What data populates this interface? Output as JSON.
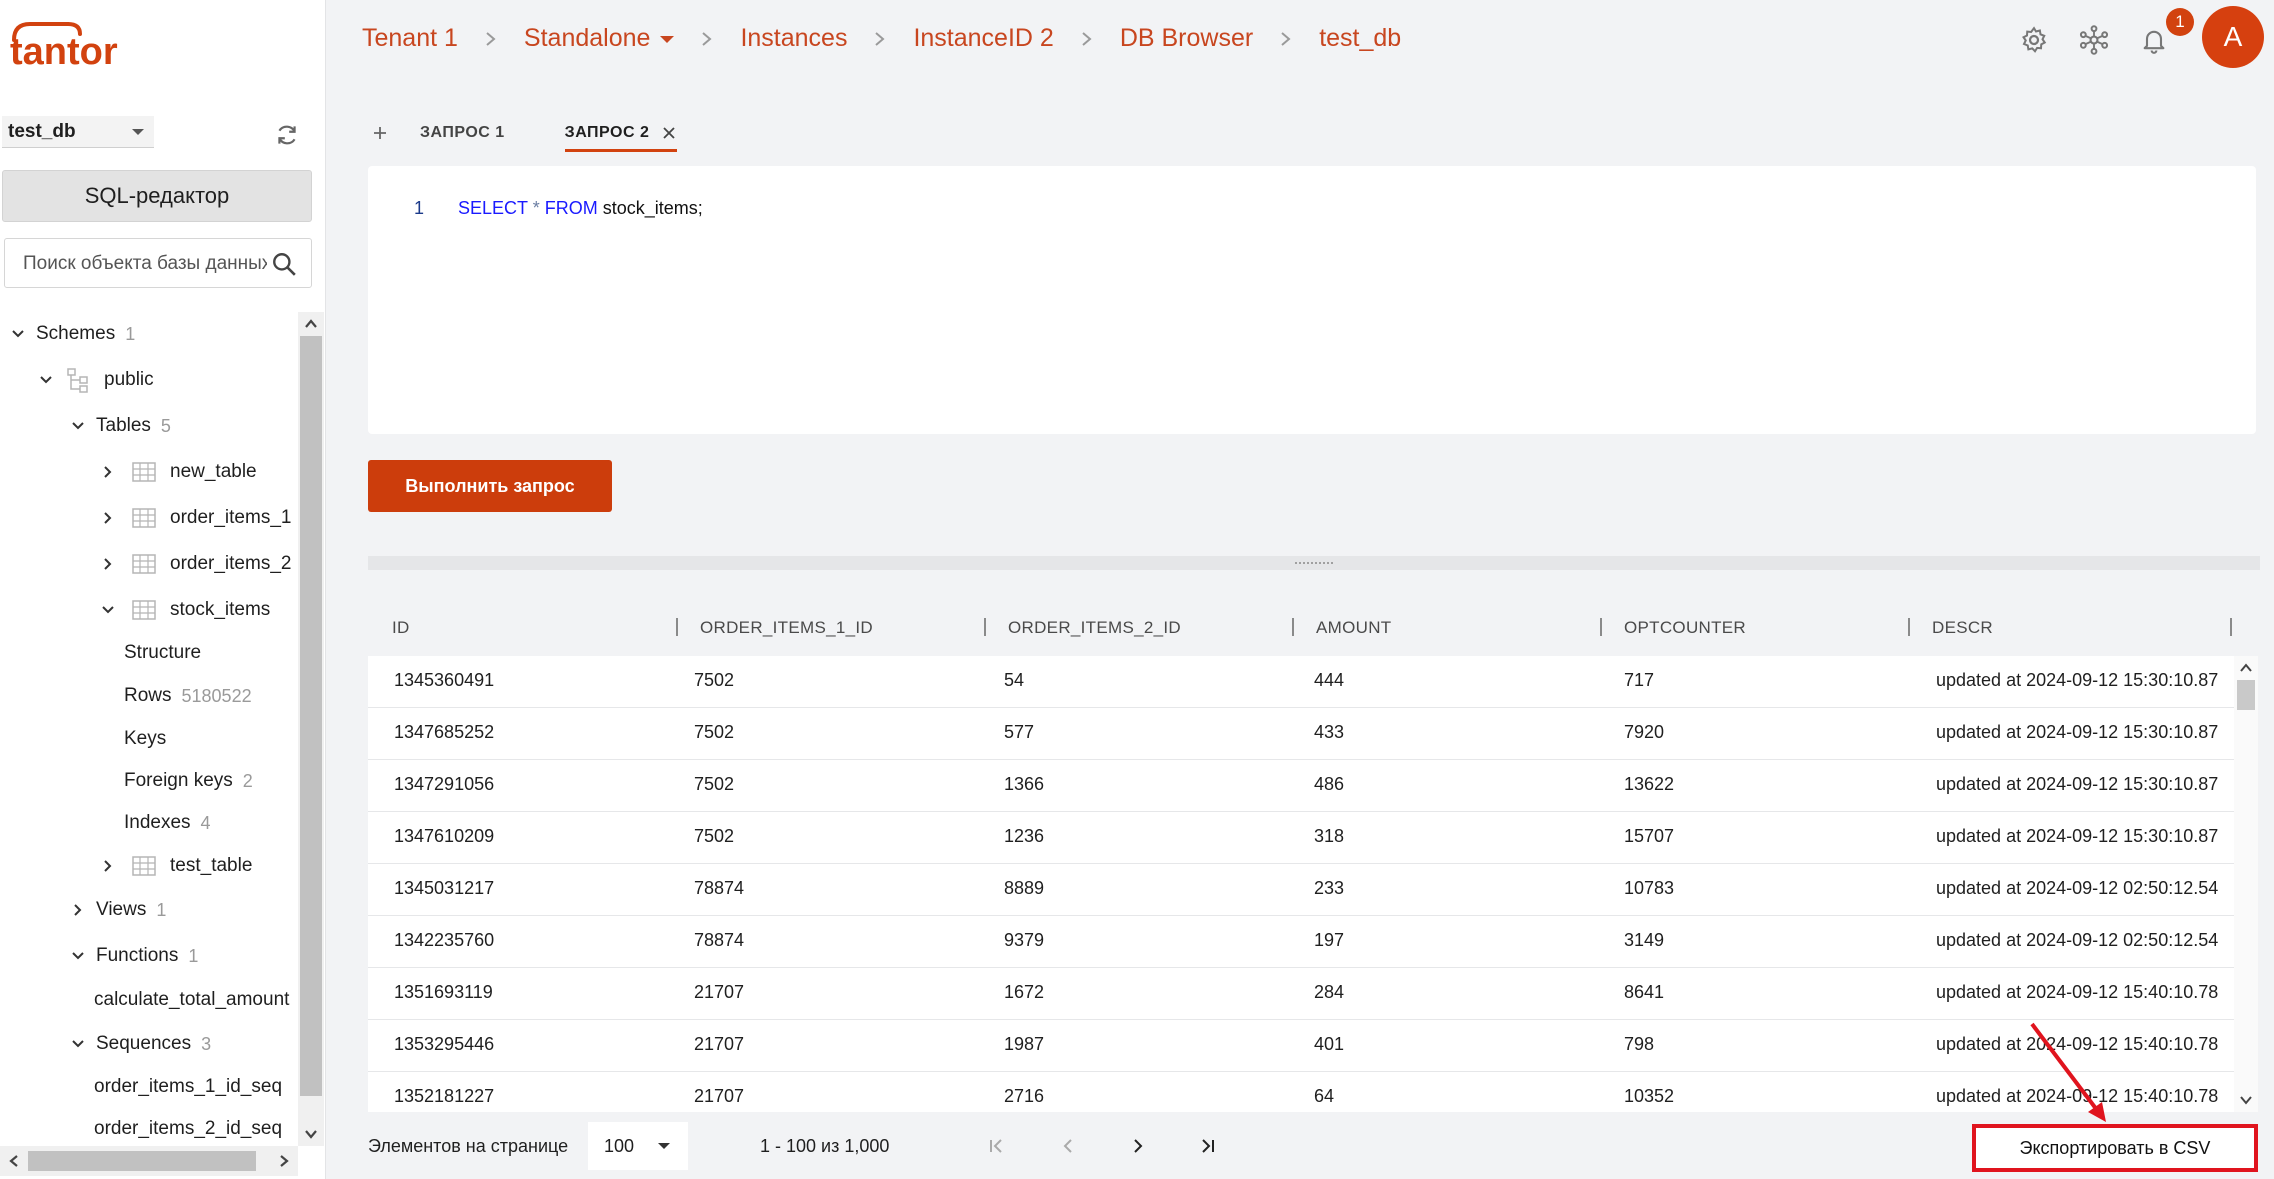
{
  "brand": {
    "logo_text": "tantor",
    "accent": "#d2420f"
  },
  "sidebar": {
    "database": "test_db",
    "sql_editor_label": "SQL-редактор",
    "search_placeholder": "Поиск объекта базы данных",
    "tree": {
      "schemes": {
        "label": "Schemes",
        "count": "1"
      },
      "public": {
        "label": "public"
      },
      "tables": {
        "label": "Tables",
        "count": "5"
      },
      "table_new": {
        "label": "new_table"
      },
      "table_oi1": {
        "label": "order_items_1"
      },
      "table_oi2": {
        "label": "order_items_2"
      },
      "table_stock": {
        "label": "stock_items"
      },
      "structure": {
        "label": "Structure"
      },
      "rows": {
        "label": "Rows",
        "count": "5180522"
      },
      "keys": {
        "label": "Keys"
      },
      "foreign_keys": {
        "label": "Foreign keys",
        "count": "2"
      },
      "indexes": {
        "label": "Indexes",
        "count": "4"
      },
      "table_test": {
        "label": "test_table"
      },
      "views": {
        "label": "Views",
        "count": "1"
      },
      "functions": {
        "label": "Functions",
        "count": "1"
      },
      "fn_calc": {
        "label": "calculate_total_amount"
      },
      "sequences": {
        "label": "Sequences",
        "count": "3"
      },
      "seq1": {
        "label": "order_items_1_id_seq"
      },
      "seq2": {
        "label": "order_items_2_id_seq"
      }
    }
  },
  "header": {
    "breadcrumb": [
      "Tenant 1",
      "Standalone",
      "Instances",
      "InstanceID 2",
      "DB Browser",
      "test_db"
    ],
    "notification_count": "1",
    "avatar_letter": "A"
  },
  "query_tabs": {
    "tab1": "ЗАПРОС 1",
    "tab2": "ЗАПРОС 2"
  },
  "editor": {
    "line_number": "1",
    "kw_select": "SELECT",
    "star": "*",
    "kw_from": "FROM",
    "rest": "stock_items;"
  },
  "run_button_label": "Выполнить запрос",
  "results": {
    "columns": [
      "ID",
      "ORDER_ITEMS_1_ID",
      "ORDER_ITEMS_2_ID",
      "AMOUNT",
      "OPTCOUNTER",
      "DESCR"
    ],
    "rows": [
      [
        "1345360491",
        "7502",
        "54",
        "444",
        "717",
        "updated at 2024-09-12 15:30:10.87"
      ],
      [
        "1347685252",
        "7502",
        "577",
        "433",
        "7920",
        "updated at 2024-09-12 15:30:10.87"
      ],
      [
        "1347291056",
        "7502",
        "1366",
        "486",
        "13622",
        "updated at 2024-09-12 15:30:10.87"
      ],
      [
        "1347610209",
        "7502",
        "1236",
        "318",
        "15707",
        "updated at 2024-09-12 15:30:10.87"
      ],
      [
        "1345031217",
        "78874",
        "8889",
        "233",
        "10783",
        "updated at 2024-09-12 02:50:12.54"
      ],
      [
        "1342235760",
        "78874",
        "9379",
        "197",
        "3149",
        "updated at 2024-09-12 02:50:12.54"
      ],
      [
        "1351693119",
        "21707",
        "1672",
        "284",
        "8641",
        "updated at 2024-09-12 15:40:10.78"
      ],
      [
        "1353295446",
        "21707",
        "1987",
        "401",
        "798",
        "updated at 2024-09-12 15:40:10.78"
      ],
      [
        "1352181227",
        "21707",
        "2716",
        "64",
        "10352",
        "updated at 2024-09-12 15:40:10.78"
      ]
    ]
  },
  "pagination": {
    "items_per_page_label": "Элементов на странице",
    "page_size": "100",
    "range": "1 - 100 из 1,000"
  },
  "export_button_label": "Экспортировать в CSV"
}
